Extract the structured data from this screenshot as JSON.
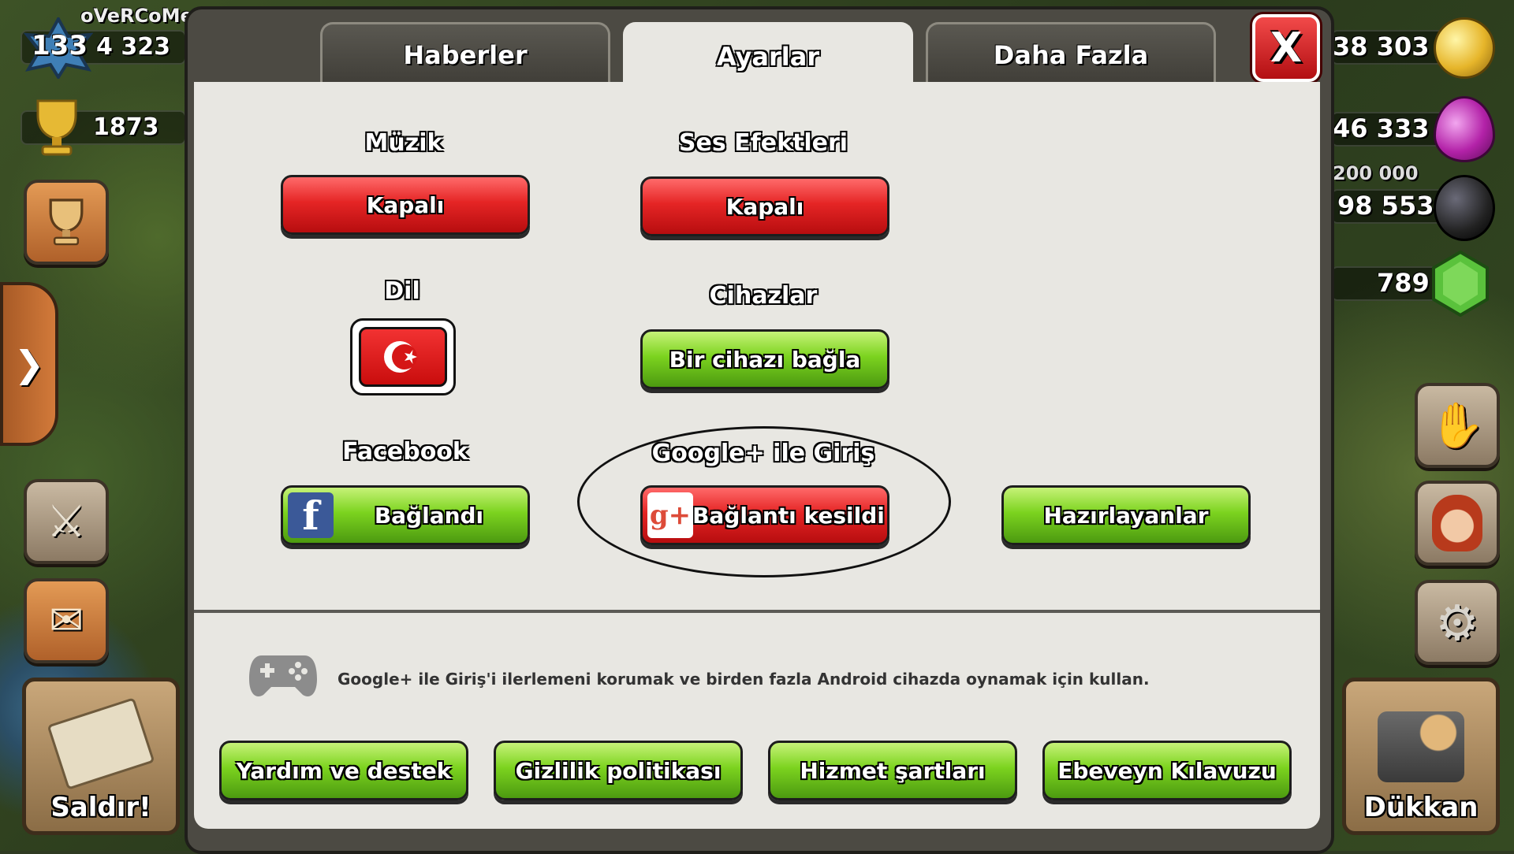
{
  "hud": {
    "player_name": "oVeRCoMe",
    "level": "133",
    "xp": "4 323",
    "trophies": "1873",
    "gold": "38 303",
    "elixir": "46 333",
    "dark_elixir_cap": "200 000",
    "dark_elixir": "98 553",
    "gems": "789",
    "attack_label": "Saldır!",
    "shop_label": "Dükkan"
  },
  "tabs": [
    {
      "label": "Haberler",
      "active": false
    },
    {
      "label": "Ayarlar",
      "active": true
    },
    {
      "label": "Daha Fazla",
      "active": false
    }
  ],
  "close_label": "X",
  "settings": {
    "music": {
      "label": "Müzik",
      "button": "Kapalı"
    },
    "sfx": {
      "label": "Ses Efektleri",
      "button": "Kapalı"
    },
    "language": {
      "label": "Dil",
      "flag": "turkey-flag-icon"
    },
    "devices": {
      "label": "Cihazlar",
      "button": "Bir cihazı bağla"
    },
    "facebook": {
      "label": "Facebook",
      "button": "Bağlandı"
    },
    "google": {
      "label": "Google+ ile Giriş",
      "button": "Bağlantı kesildi"
    },
    "credits": {
      "button": "Hazırlayanlar"
    }
  },
  "info": {
    "text": "Google+ ile Giriş'i ilerlemeni korumak ve birden fazla Android cihazda oynamak için kullan.",
    "icon": "gamepad-icon"
  },
  "footer": [
    {
      "label": "Yardım ve destek"
    },
    {
      "label": "Gizlilik politikası"
    },
    {
      "label": "Hizmet şartları"
    },
    {
      "label": "Ebeveyn Kılavuzu"
    }
  ],
  "colors": {
    "red_button": "#e52525",
    "green_button": "#7cd31f",
    "panel_bg": "#e8e7e2",
    "frame": "#4c4a43"
  }
}
